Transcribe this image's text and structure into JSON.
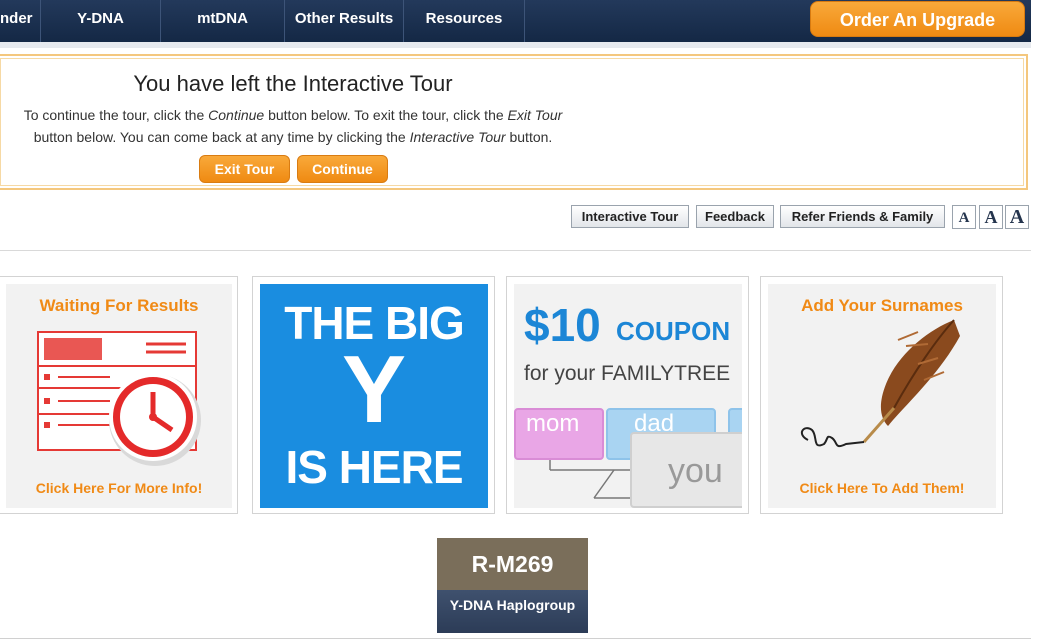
{
  "nav": {
    "items": [
      "nder",
      "Y-DNA",
      "mtDNA",
      "Other Results",
      "Resources"
    ],
    "upgrade_label": "Order An Upgrade"
  },
  "tour": {
    "title": "You have left the Interactive Tour",
    "line1_a": "To continue the tour, click the ",
    "line1_b": "Continue",
    "line1_c": " button below. To exit the tour, click the ",
    "line1_d": "Exit Tour",
    "line2_a": "button below. You can come back at any time by clicking the ",
    "line2_b": "Interactive Tour",
    "line2_c": " button.",
    "exit_label": "Exit Tour",
    "continue_label": "Continue"
  },
  "utility": {
    "interactive_tour": "Interactive Tour",
    "feedback": "Feedback",
    "refer": "Refer Friends & Family",
    "font_sizes": [
      "A",
      "A",
      "A"
    ]
  },
  "tiles": {
    "waiting": {
      "title": "Waiting For Results",
      "link": "Click Here For More Info!"
    },
    "bigy": {
      "line1": "THE BIG",
      "line2": "Y",
      "line3": "IS HERE"
    },
    "coupon": {
      "amount": "$10",
      "word": "COUPON",
      "for_text": "for your FAMILYTREE",
      "card1": "mom",
      "card2": "dad",
      "card3": "you"
    },
    "surnames": {
      "title": "Add Your Surnames",
      "link": "Click Here To Add Them!"
    }
  },
  "haplogroup": {
    "value": "R-M269",
    "label": "Y-DNA Haplogroup"
  },
  "colors": {
    "nav": "#1b3050",
    "accent": "#f08a16",
    "bigy_blue": "#1a8de0",
    "haplo_top": "#7a6e5a"
  }
}
